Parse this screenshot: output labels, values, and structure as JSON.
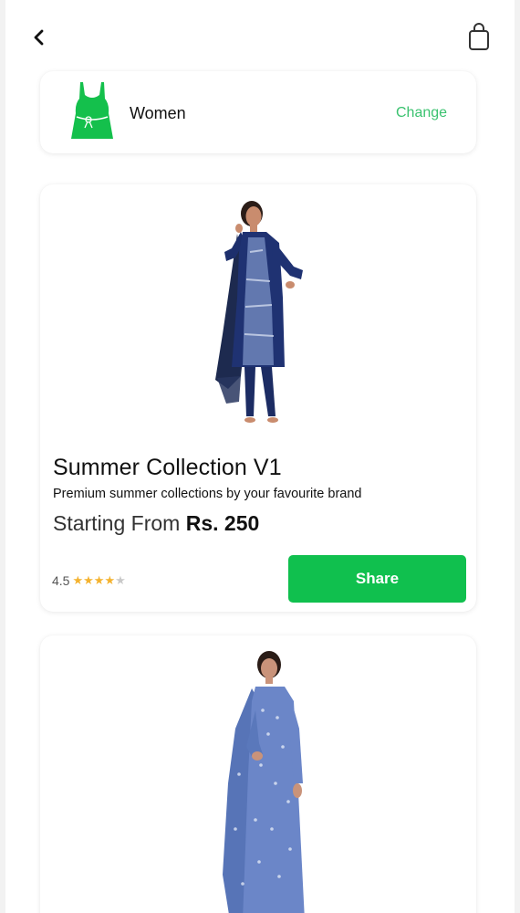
{
  "header": {
    "back_icon": "chevron-left-icon",
    "cart_icon": "shopping-bag-icon"
  },
  "category": {
    "icon": "dress-icon",
    "name": "Women",
    "change_label": "Change",
    "accent_color": "#3ac26f"
  },
  "products": [
    {
      "title": "Summer Collection V1",
      "description": "Premium summer collections by your favourite brand",
      "price_prefix": "Starting From",
      "price": "Rs. 250",
      "rating": "4.5",
      "stars_filled": 4,
      "stars_total": 5,
      "share_label": "Share",
      "image": "model-navy-kurta-image"
    },
    {
      "image": "model-blue-kurta-image"
    }
  ],
  "colors": {
    "primary_button": "#10c04e",
    "star": "#f4b22e",
    "star_empty": "#c9c9c9"
  }
}
